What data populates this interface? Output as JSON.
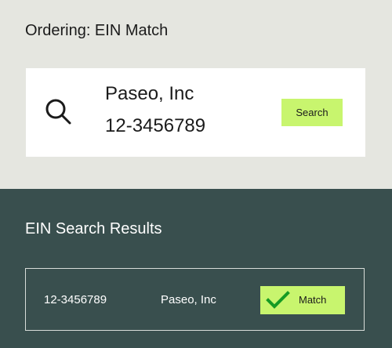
{
  "ordering": {
    "title": "Ordering: EIN Match",
    "company_name": "Paseo, Inc",
    "ein": "12-3456789",
    "search_label": "Search"
  },
  "results": {
    "title": "EIN Search Results",
    "rows": [
      {
        "ein": "12-3456789",
        "company_name": "Paseo, Inc",
        "status_label": "Match"
      }
    ]
  },
  "icons": {
    "search": "search-icon",
    "match": "check-icon"
  },
  "colors": {
    "top_background": "#e5e6e0",
    "card_background": "#ffffff",
    "bottom_background": "#394f4e",
    "accent": "#c8f56e",
    "check": "#169b24",
    "text_dark": "#1b1b1b",
    "text_light": "#ffffff"
  }
}
